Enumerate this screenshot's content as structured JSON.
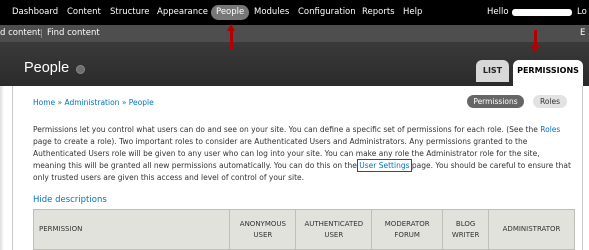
{
  "toolbar": {
    "items": [
      "Dashboard",
      "Content",
      "Structure",
      "Appearance",
      "People",
      "Modules",
      "Configuration",
      "Reports",
      "Help"
    ],
    "hello": "Hello",
    "logout_fragment": "Lo"
  },
  "shortcuts": {
    "items": [
      "d content",
      "Find content"
    ],
    "edit_fragment": "E"
  },
  "header": {
    "title": "People"
  },
  "tabs": [
    "LIST",
    "PERMISSIONS"
  ],
  "breadcrumb": {
    "items": [
      "Home",
      "Administration",
      "People"
    ],
    "separator": "»"
  },
  "secondary_tabs": [
    "Permissions",
    "Roles"
  ],
  "description": {
    "part1": "Permissions let you control what users can do and see on your site. You can define a specific set of permissions for each role. (See the ",
    "roles_link": "Roles",
    "part2": " page to create a role). Two important roles to consider are Authenticated Users and Administrators. Any permissions granted to the Authenticated Users role will be given to any user who can log into your site. You can make any role the Administrator role for the site, meaning this will be granted all new permissions automatically. You can do this on the ",
    "user_settings_link": "User Settings",
    "part3": " page. You should be careful to ensure that only trusted users are given this access and level of control of your site."
  },
  "hide_descriptions": "Hide descriptions",
  "table": {
    "headers": [
      {
        "line1": "PERMISSION",
        "line2": ""
      },
      {
        "line1": "ANONYMOUS",
        "line2": "USER"
      },
      {
        "line1": "AUTHENTICATED",
        "line2": "USER"
      },
      {
        "line1": "MODERATOR",
        "line2": "FORUM"
      },
      {
        "line1": "BLOG",
        "line2": "WRITER"
      },
      {
        "line1": "ADMINISTRATOR",
        "line2": ""
      }
    ]
  },
  "colors": {
    "toolbar_bg": "#000000",
    "shortcut_bg": "#4e4e4e",
    "header_bg": "#333333",
    "link": "#0074bd",
    "annotation_red": "#b40000"
  }
}
